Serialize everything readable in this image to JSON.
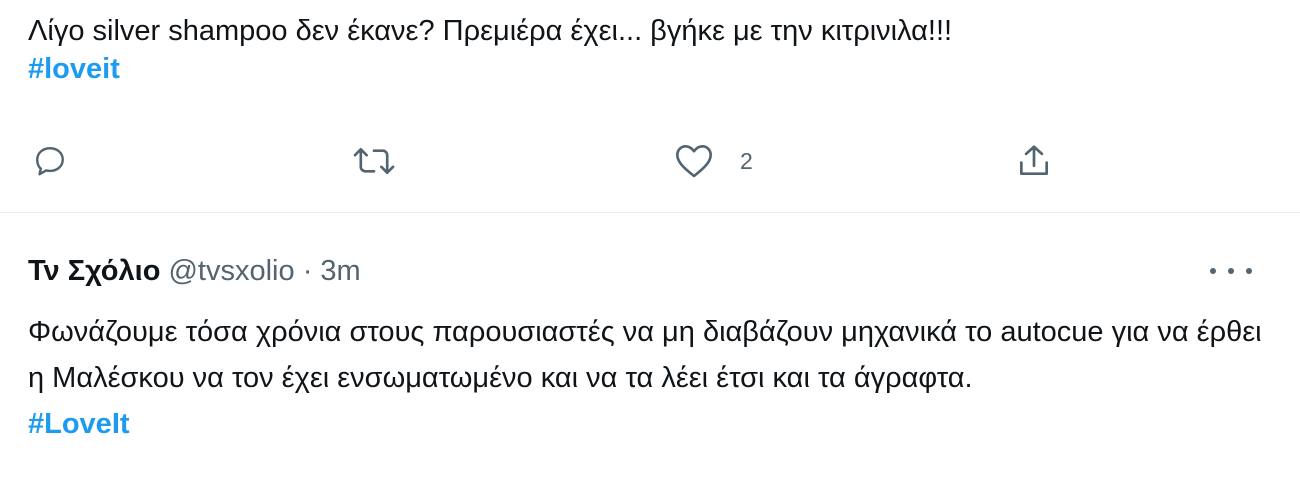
{
  "tweet1": {
    "text": "Λίγο silver shampoo δεν έκανε? Πρεμιέρα έχει... βγήκε με την κιτρινιλα!!!",
    "hashtag": "#loveit",
    "actions": {
      "reply_icon": "reply-icon",
      "retweet_icon": "retweet-icon",
      "like_icon": "heart-icon",
      "like_count": "2",
      "share_icon": "share-icon"
    }
  },
  "tweet2": {
    "author_name": "Τν Σχόλιο",
    "handle": "@tvsxolio",
    "separator": "·",
    "time": "3m",
    "text": "Φωνάζουμε τόσα χρόνια στους παρουσιαστές να μη διαβάζουν μηχανικά το autocue για να έρθει η Μαλέσκου να τον έχει ενσωματωμένο και να τα λέει έτσι και τα άγραφτα.",
    "hashtag": "#LoveIt",
    "more_icon": "more-dots-icon"
  },
  "colors": {
    "accent": "#1d9bf0",
    "secondary_text": "#536471",
    "divider": "#e6ecf0"
  }
}
